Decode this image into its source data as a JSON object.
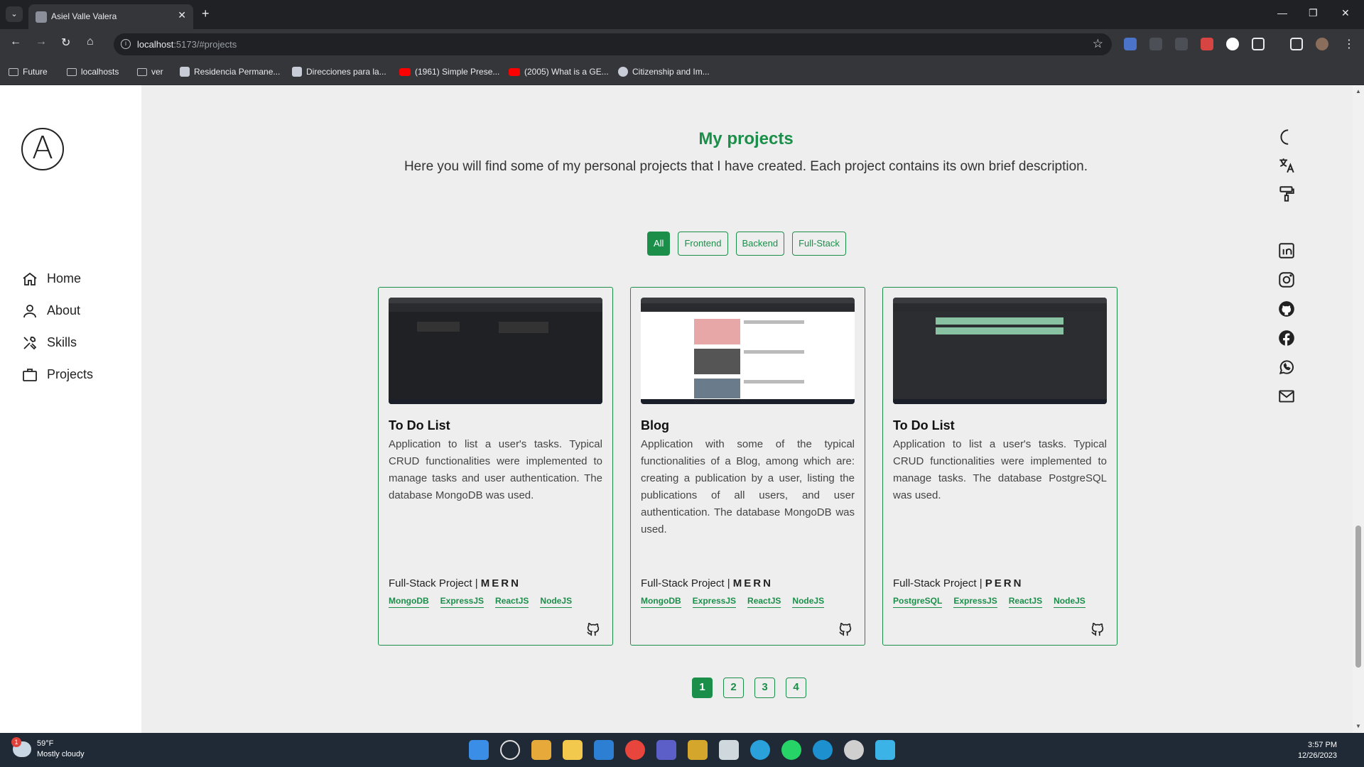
{
  "browser": {
    "tab_title": "Asiel Valle Valera",
    "url_host": "localhost",
    "url_rest": ":5173/#projects",
    "bookmarks": [
      {
        "label": "Future",
        "kind": "folder"
      },
      {
        "label": "localhosts",
        "kind": "folder"
      },
      {
        "label": "ver",
        "kind": "folder"
      },
      {
        "label": "Residencia Permane...",
        "kind": "site"
      },
      {
        "label": "Direcciones para la...",
        "kind": "site"
      },
      {
        "label": "(1961) Simple Prese...",
        "kind": "youtube"
      },
      {
        "label": "(2005) What is a GE...",
        "kind": "youtube"
      },
      {
        "label": "Citizenship and Im...",
        "kind": "site"
      }
    ]
  },
  "sidebar": {
    "logo_letter": "A",
    "items": [
      {
        "label": "Home",
        "icon": "home-icon"
      },
      {
        "label": "About",
        "icon": "user-icon"
      },
      {
        "label": "Skills",
        "icon": "tools-icon"
      },
      {
        "label": "Projects",
        "icon": "briefcase-icon"
      }
    ]
  },
  "main": {
    "title": "My projects",
    "subtitle": "Here you will find some of my personal projects that I have created. Each project contains its own brief description.",
    "filters": [
      "All",
      "Frontend",
      "Backend",
      "Full-Stack"
    ],
    "active_filter": "All",
    "projects": [
      {
        "title": "To Do List",
        "description": "Application to list a user's tasks. Typical CRUD functionalities were implemented to manage tasks and user authentication. The database MongoDB was used.",
        "type_label": "Full-Stack Project | ",
        "stack": "MERN",
        "techs": [
          "MongoDB",
          "ExpressJS",
          "ReactJS",
          "NodeJS"
        ]
      },
      {
        "title": "Blog",
        "description": "Application with some of the typical functionalities of a Blog, among which are: creating a publication by a user, listing the publications of all users, and user authentication. The database MongoDB was used.",
        "type_label": "Full-Stack Project | ",
        "stack": "MERN",
        "techs": [
          "MongoDB",
          "ExpressJS",
          "ReactJS",
          "NodeJS"
        ]
      },
      {
        "title": "To Do List",
        "description": "Application to list a user's tasks. Typical CRUD functionalities were implemented to manage tasks. The database PostgreSQL was used.",
        "type_label": "Full-Stack Project | ",
        "stack": "PERN",
        "techs": [
          "PostgreSQL",
          "ExpressJS",
          "ReactJS",
          "NodeJS"
        ]
      }
    ],
    "pages": [
      "1",
      "2",
      "3",
      "4"
    ],
    "active_page": "1"
  },
  "right_icons": [
    "moon-icon",
    "translate-icon",
    "paint-roller-icon",
    "linkedin-icon",
    "instagram-icon",
    "github-icon",
    "facebook-icon",
    "whatsapp-icon",
    "mail-icon"
  ],
  "taskbar": {
    "temperature": "59°F",
    "weather": "Mostly cloudy",
    "weather_badge": "1",
    "time": "3:57 PM",
    "date": "12/26/2023"
  },
  "colors": {
    "accent": "#1b8f4a",
    "sidebar_bg": "#ffffff",
    "content_bg": "#eeeeee"
  }
}
